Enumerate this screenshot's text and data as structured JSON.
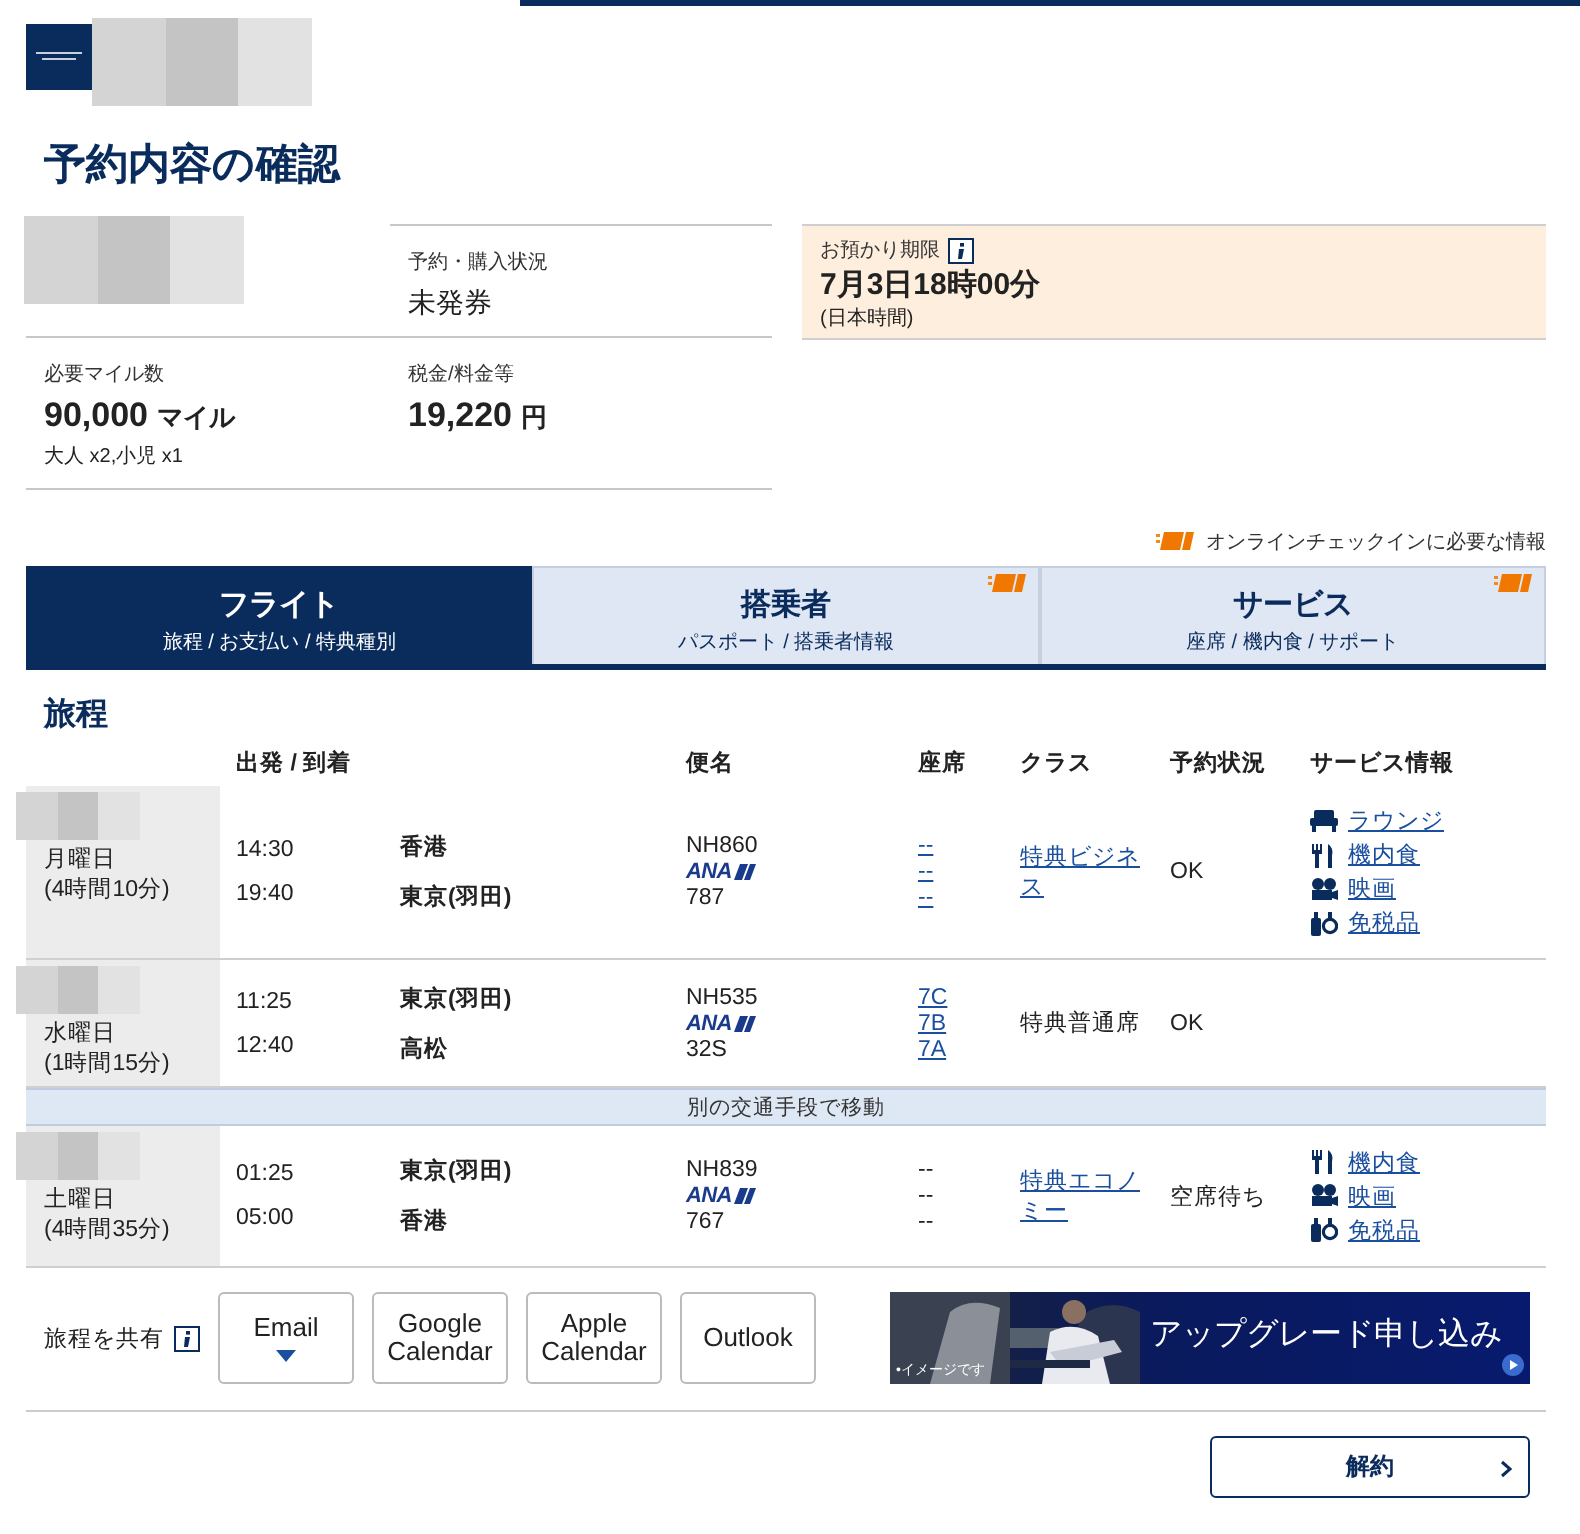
{
  "header": {
    "title": "予約内容の確認"
  },
  "summary": {
    "booking_status": {
      "label": "予約・購入状況",
      "value": "未発券"
    },
    "miles": {
      "label": "必要マイル数",
      "value": "90,000",
      "unit": "マイル",
      "note": "大人 x2,小児 x1"
    },
    "taxes": {
      "label": "税金/料金等",
      "value": "19,220",
      "unit": "円"
    },
    "deadline": {
      "label": "お預かり期限",
      "value": "7月3日18時00分",
      "note": "(日本時間)"
    }
  },
  "checkin_note": "オンラインチェックインに必要な情報",
  "tabs": [
    {
      "title": "フライト",
      "subtitle": "旅程 / お支払い / 特典種別",
      "selected": true,
      "checkin_required": false
    },
    {
      "title": "搭乗者",
      "subtitle": "パスポート / 搭乗者情報",
      "selected": false,
      "checkin_required": true
    },
    {
      "title": "サービス",
      "subtitle": "座席 / 機内食 / サポート",
      "selected": false,
      "checkin_required": true
    }
  ],
  "itinerary": {
    "heading": "旅程",
    "columns": [
      "出発 / 到着",
      "便名",
      "座席",
      "クラス",
      "予約状況",
      "サービス情報"
    ],
    "rows": [
      {
        "kind": "flight",
        "day": "月曜日",
        "duration": "(4時間10分)",
        "departure_time": "14:30",
        "departure": "香港",
        "arrival_time": "19:40",
        "arrival": "東京(羽田)",
        "flight": "NH860",
        "carrier": "ANA",
        "aircraft": "787",
        "seats": [
          "--",
          "--",
          "--"
        ],
        "seats_linked": true,
        "class": "特典ビジネス",
        "class_linked": true,
        "status": "OK",
        "services": [
          {
            "kind": "lounge",
            "label": "ラウンジ"
          },
          {
            "kind": "meal",
            "label": "機内食"
          },
          {
            "kind": "movie",
            "label": "映画"
          },
          {
            "kind": "dutyfree",
            "label": "免税品"
          }
        ]
      },
      {
        "kind": "flight",
        "day": "水曜日",
        "duration": "(1時間15分)",
        "departure_time": "11:25",
        "departure": "東京(羽田)",
        "arrival_time": "12:40",
        "arrival": "高松",
        "flight": "NH535",
        "carrier": "ANA",
        "aircraft": "32S",
        "seats": [
          "7C",
          "7B",
          "7A"
        ],
        "seats_linked": true,
        "class": "特典普通席",
        "class_linked": false,
        "status": "OK",
        "services": []
      },
      {
        "kind": "transfer",
        "text": "別の交通手段で移動"
      },
      {
        "kind": "flight",
        "day": "土曜日",
        "duration": "(4時間35分)",
        "departure_time": "01:25",
        "departure": "東京(羽田)",
        "arrival_time": "05:00",
        "arrival": "香港",
        "flight": "NH839",
        "carrier": "ANA",
        "aircraft": "767",
        "seats": [
          "--",
          "--",
          "--"
        ],
        "seats_linked": false,
        "class": "特典エコノミー",
        "class_linked": true,
        "status": "空席待ち",
        "services": [
          {
            "kind": "meal",
            "label": "機内食"
          },
          {
            "kind": "movie",
            "label": "映画"
          },
          {
            "kind": "dutyfree",
            "label": "免税品"
          }
        ]
      }
    ]
  },
  "share": {
    "label": "旅程を共有",
    "buttons": [
      {
        "label": "Email",
        "has_menu": true
      },
      {
        "label": "Google Calendar",
        "has_menu": false
      },
      {
        "label": "Apple Calendar",
        "has_menu": false
      },
      {
        "label": "Outlook",
        "has_menu": false
      }
    ]
  },
  "banner": {
    "text": "アップグレード申し込み",
    "caption": "•イメージです"
  },
  "cancel_button": "解約"
}
